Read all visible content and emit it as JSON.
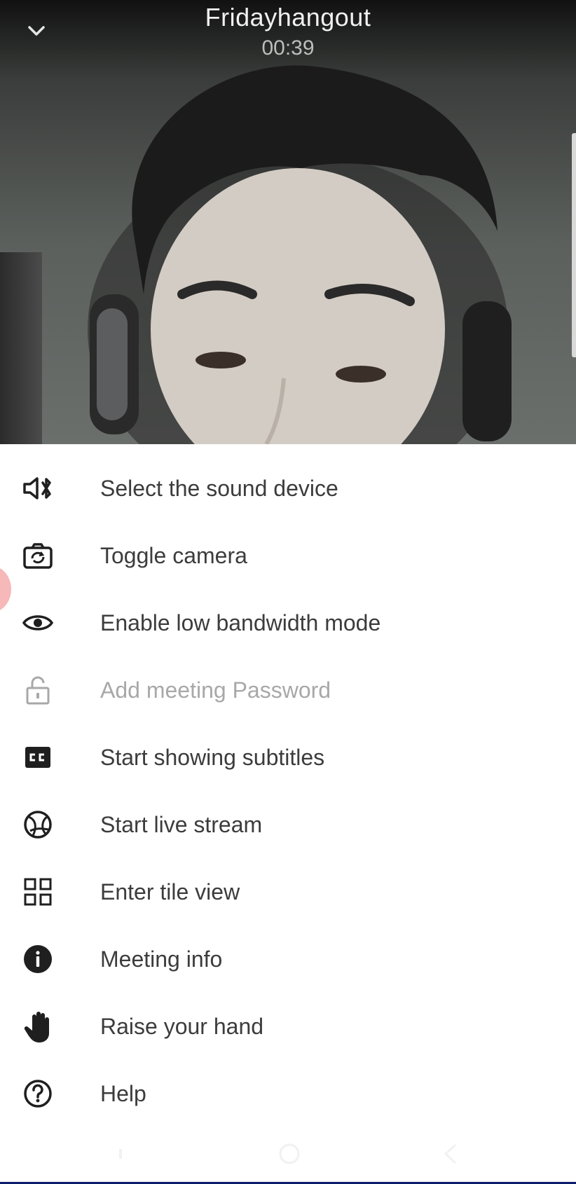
{
  "call": {
    "title": "Fridayhangout",
    "timer": "00:39"
  },
  "menu": {
    "items": [
      {
        "label": "Select the sound device",
        "icon": "speaker-bluetooth-icon",
        "enabled": true
      },
      {
        "label": "Toggle camera",
        "icon": "camera-switch-icon",
        "enabled": true
      },
      {
        "label": "Enable low bandwidth mode",
        "icon": "eye-icon",
        "enabled": true
      },
      {
        "label": "Add meeting Password",
        "icon": "lock-icon",
        "enabled": false
      },
      {
        "label": "Start showing subtitles",
        "icon": "closed-captions-icon",
        "enabled": true
      },
      {
        "label": "Start live stream",
        "icon": "globe-icon",
        "enabled": true
      },
      {
        "label": "Enter tile view",
        "icon": "tile-grid-icon",
        "enabled": true
      },
      {
        "label": "Meeting info",
        "icon": "info-icon",
        "enabled": true
      },
      {
        "label": "Raise your hand",
        "icon": "hand-icon",
        "enabled": true
      },
      {
        "label": "Help",
        "icon": "help-icon",
        "enabled": true
      }
    ]
  },
  "colors": {
    "menu_text": "#3c3c3c",
    "disabled_text": "#a8a8a8",
    "icon": "#1f1f1f",
    "accent_line": "#0c1d6b"
  }
}
